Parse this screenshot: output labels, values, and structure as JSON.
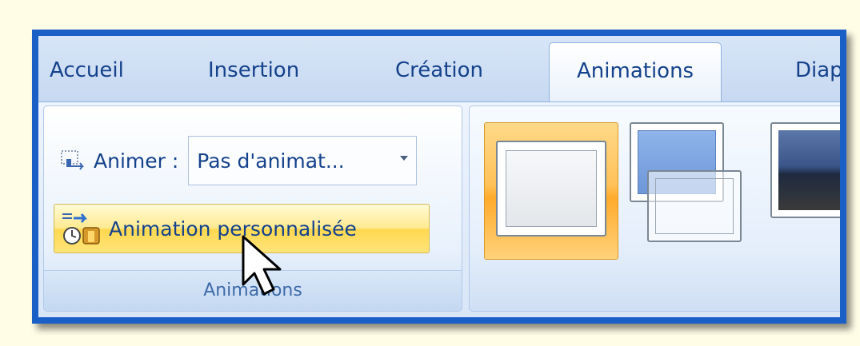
{
  "tabs": [
    {
      "label": "Accueil"
    },
    {
      "label": "Insertion"
    },
    {
      "label": "Création"
    },
    {
      "label": "Animations"
    },
    {
      "label": "Diap"
    }
  ],
  "active_tab": "Animations",
  "animations_group": {
    "animer_label": "Animer :",
    "animer_value": "Pas d'animat...",
    "custom_button_label": "Animation personnalisée",
    "group_label": "Animations"
  },
  "gallery": {
    "selected_index": 0,
    "items": [
      "no-transition",
      "fade-transition",
      "dark-transition"
    ]
  },
  "colors": {
    "frame_border": "#1a5fc6",
    "text": "#15428b",
    "highlight": "#ffc25a"
  }
}
